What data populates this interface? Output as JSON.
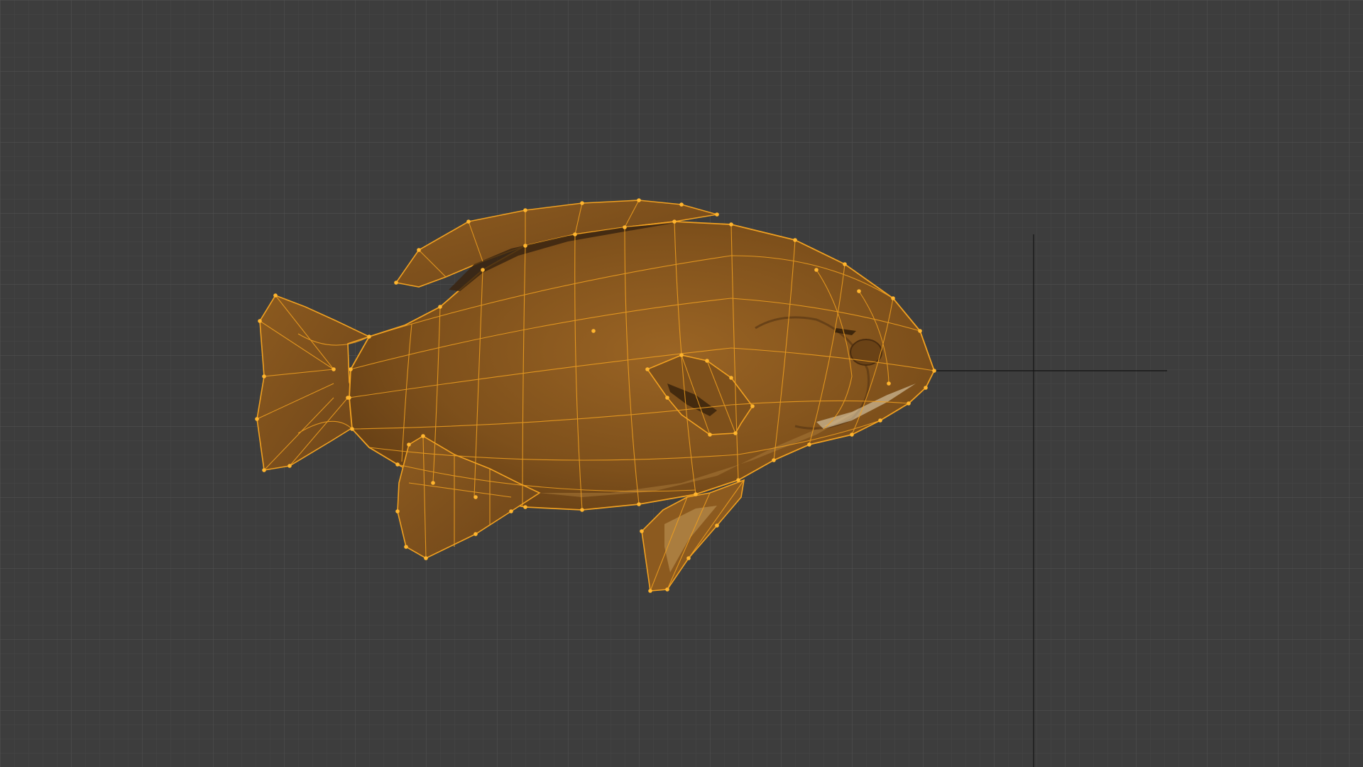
{
  "viewport": {
    "view": "3d-viewport",
    "shading": "wireframe-overlay",
    "grid_visible": true,
    "origin_axes_visible": true
  },
  "scene": {
    "selected_object": {
      "kind": "fish-mesh",
      "selected": true,
      "edit_mode": true
    }
  },
  "colors": {
    "background": "#3d3d3d",
    "grid_minor": "#474747",
    "grid_major": "#4f4f4f",
    "selection_wire": "#f0a020",
    "vertex": "#ffb52e",
    "mesh_body": "#8a5a1e",
    "mesh_fin": "#7c5220",
    "mesh_belly": "#a87838",
    "stripe": "#3a2410",
    "axis_line": "#151515"
  }
}
